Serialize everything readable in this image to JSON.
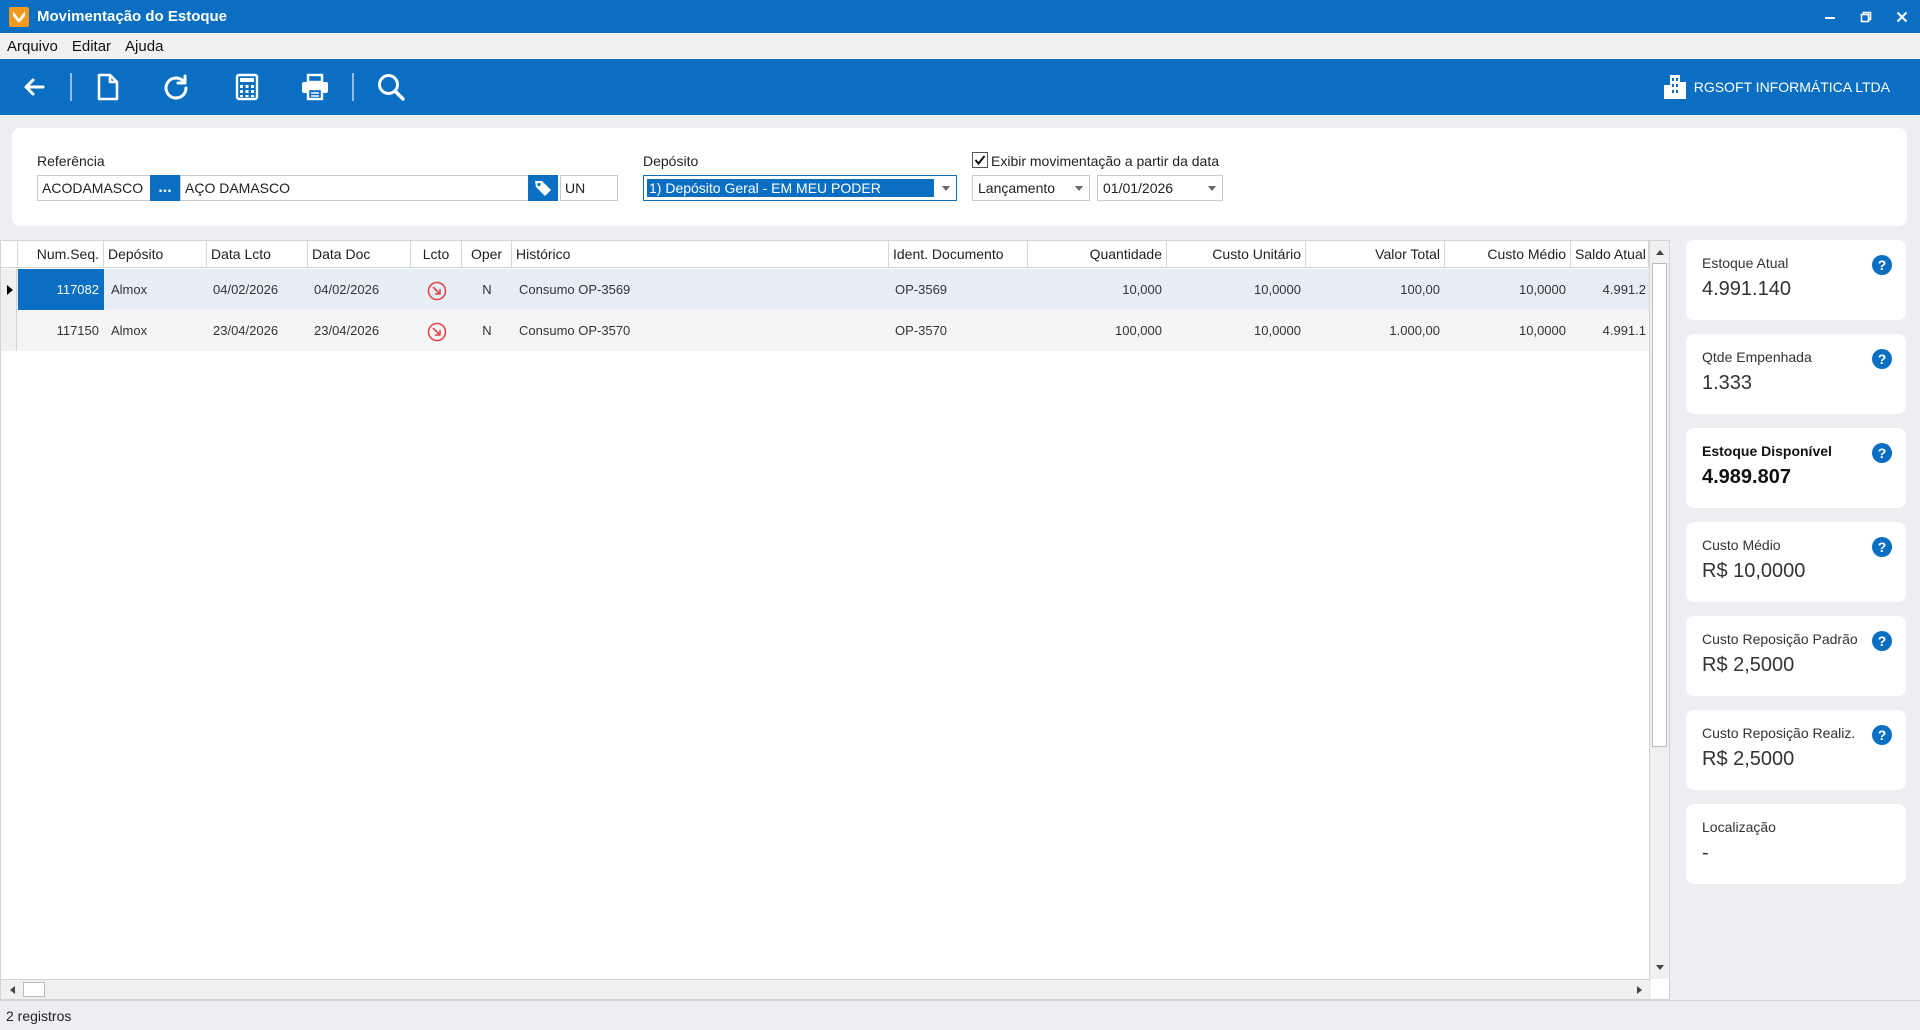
{
  "window": {
    "title": "Movimentação do Estoque"
  },
  "menu": [
    "Arquivo",
    "Editar",
    "Ajuda"
  ],
  "toolbar": {
    "company": "RGSOFT INFORMÁTICA LTDA"
  },
  "filters": {
    "referencia_label": "Referência",
    "referencia_code": "ACODAMASCO",
    "referencia_browse": "...",
    "referencia_desc": "AÇO DAMASCO",
    "unidade": "UN",
    "deposito_label": "Depósito",
    "deposito_value": "1) Depósito Geral - EM MEU PODER",
    "exibir_label": "Exibir movimentação a partir da data",
    "exibir_checked": true,
    "date_type": "Lançamento",
    "date_value": "01/01/2026"
  },
  "grid": {
    "columns": [
      "Num.Seq.",
      "Depósito",
      "Data Lcto",
      "Data Doc",
      "Lcto",
      "Oper",
      "Histórico",
      "Ident. Documento",
      "Quantidade",
      "Custo Unitário",
      "Valor Total",
      "Custo Médio",
      "Saldo Atual"
    ],
    "rows": [
      {
        "num_seq": "117082",
        "deposito": "Almox",
        "data_lcto": "04/02/2026",
        "data_doc": "04/02/2026",
        "lcto": "saida-icon",
        "oper": "N",
        "historico": "Consumo OP-3569",
        "ident_documento": "OP-3569",
        "quantidade": "10,000",
        "custo_unitario": "10,0000",
        "valor_total": "100,00",
        "custo_medio": "10,0000",
        "saldo_atual": "4.991.2"
      },
      {
        "num_seq": "117150",
        "deposito": "Almox",
        "data_lcto": "23/04/2026",
        "data_doc": "23/04/2026",
        "lcto": "saida-icon",
        "oper": "N",
        "historico": "Consumo OP-3570",
        "ident_documento": "OP-3570",
        "quantidade": "100,000",
        "custo_unitario": "10,0000",
        "valor_total": "1.000,00",
        "custo_medio": "10,0000",
        "saldo_atual": "4.991.1"
      }
    ]
  },
  "stats": [
    {
      "label": "Estoque Atual",
      "value": "4.991.140",
      "help": true
    },
    {
      "label": "Qtde Empenhada",
      "value": "1.333",
      "help": true
    },
    {
      "label": "Estoque Disponível",
      "value": "4.989.807",
      "help": true
    },
    {
      "label": "Custo Médio",
      "value": "R$ 10,0000",
      "help": true
    },
    {
      "label": "Custo Reposição Padrão",
      "value": "R$ 2,5000",
      "help": true
    },
    {
      "label": "Custo Reposição Realiz.",
      "value": "R$ 2,5000",
      "help": true
    },
    {
      "label": "Localização",
      "value": "-",
      "help": false
    }
  ],
  "help_glyph": "?",
  "status": {
    "text": "2 registros"
  },
  "colors": {
    "accent": "#0a6fc2",
    "danger": "#e2474a"
  }
}
